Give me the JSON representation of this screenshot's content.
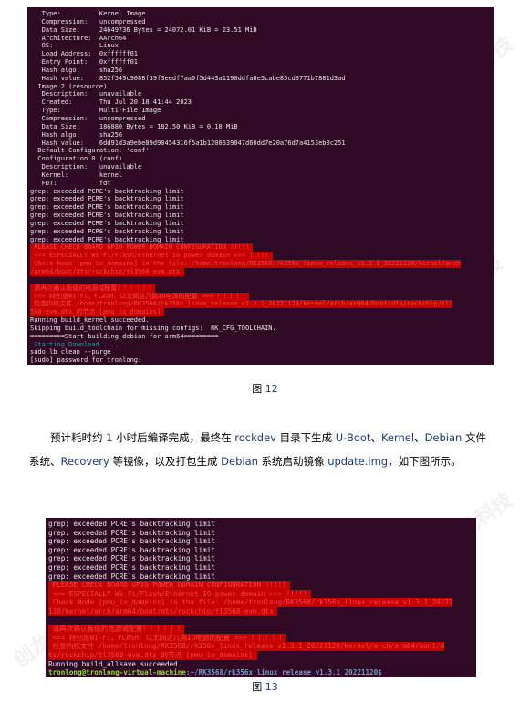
{
  "figure12": {
    "caption_prefix": "图",
    "caption_num": "12",
    "lines": [
      {
        "t": "   Type:          Kernel Image"
      },
      {
        "t": "   Compression:   uncompressed"
      },
      {
        "t": "   Data Size:     24649736 Bytes = 24072.01 KiB = 23.51 MiB"
      },
      {
        "t": "   Architecture:  AArch64"
      },
      {
        "t": "   OS:            Linux"
      },
      {
        "t": "   Load Address:  0xffffff01"
      },
      {
        "t": "   Entry Point:   0xffffff01"
      },
      {
        "t": "   Hash algo:     sha256"
      },
      {
        "t": "   Hash value:    852f549c9088f39f3eedf7aa0f5d443a1190ddfa8e3cabe85cd8771b7881d3ad"
      },
      {
        "t": "  Image 2 (resource)"
      },
      {
        "t": "   Description:   unavailable"
      },
      {
        "t": "   Created:       Thu Jul 20 18:41:44 2023"
      },
      {
        "t": "   Type:          Multi-File Image"
      },
      {
        "t": "   Compression:   uncompressed"
      },
      {
        "t": "   Data Size:     186880 Bytes = 182.50 KiB = 0.18 MiB"
      },
      {
        "t": "   Hash algo:     sha256"
      },
      {
        "t": "   Hash value:    6dd91d3a9ebe89d90454316f5a1b1200639047d60dd7e20a76d7a4153eb0c251"
      },
      {
        "t": "  Default Configuration: 'conf'"
      },
      {
        "t": "  Configuration 0 (conf)"
      },
      {
        "t": "   Description:   unavailable"
      },
      {
        "t": "   Kernel:        kernel"
      },
      {
        "t": "   FDT:           fdt"
      },
      {
        "t": "grep: exceeded PCRE's backtracking limit"
      },
      {
        "t": "grep: exceeded PCRE's backtracking limit"
      },
      {
        "t": "grep: exceeded PCRE's backtracking limit"
      },
      {
        "t": "grep: exceeded PCRE's backtracking limit"
      },
      {
        "t": "grep: exceeded PCRE's backtracking limit"
      },
      {
        "t": "grep: exceeded PCRE's backtracking limit"
      },
      {
        "t": "grep: exceeded PCRE's backtracking limit"
      },
      {
        "t": " PLEASE CHECK BOARD GPIO POWER DOMAIN CONFIGURATION !!!!! ",
        "s": "red"
      },
      {
        "t": " <<< ESPECIALLY Wi-Fi/Flash/Ethernet IO power domain >>> !!!!! ",
        "s": "red"
      },
      {
        "t": " Check Node [pmu_io_domains] in the file: /home/tronlong/RK3568/rk356x_linux_release_v1.3.1_20221120/kernel/arch",
        "s": "red"
      },
      {
        "t": "/arm64/boot/dts/rockchip/tl3568-evm.dts ",
        "s": "red"
      },
      {
        "t": ""
      },
      {
        "t": " 请再次确认板级的电源域配置！！！！！！",
        "s": "red"
      },
      {
        "t": " <<< 特别是Wi-Fi，FLASH，以太网这几路IO电源的配置 >>> ！！！！！",
        "s": "red"
      },
      {
        "t": " 检查内核文件 /home/tronlong/RK3568/rk356x_linux_release_v1.3.1_20221120/kernel/arch/arm64/boot/dts/rockchip/tl3",
        "s": "red"
      },
      {
        "t": "568-evm.dts 的节点 [pmu_io_domains] ",
        "s": "red"
      },
      {
        "t": "Running build_kernel succeeded."
      },
      {
        "t": "Skipping build_toolchain for missing configs:  RK_CFG_TOOLCHAIN."
      },
      {
        "t": "=========Start building debian for arm64========="
      },
      {
        "t": " Starting Download......",
        "s": "cyan"
      },
      {
        "t": "sudo lb clean --purge"
      },
      {
        "t": "[sudo] password for tronlong:"
      }
    ]
  },
  "paragraph": {
    "parts": [
      {
        "t": "预计耗时约 "
      },
      {
        "t": "1",
        "en": true
      },
      {
        "t": " 小时后编译完成，最终在 "
      },
      {
        "t": "rockdev",
        "en": true
      },
      {
        "t": " 目录下生成 "
      },
      {
        "t": "U-Boot",
        "en": true
      },
      {
        "t": "、"
      },
      {
        "t": "Kernel",
        "en": true
      },
      {
        "t": "、"
      },
      {
        "t": "Debian",
        "en": true
      },
      {
        "t": " 文件系统、"
      },
      {
        "t": "Recovery",
        "en": true
      },
      {
        "t": " 等镜像，以及打包生成 "
      },
      {
        "t": "Debian",
        "en": true
      },
      {
        "t": " 系统启动镜像 "
      },
      {
        "t": "update.img",
        "en": true
      },
      {
        "t": "，如下图所示。"
      }
    ]
  },
  "figure13": {
    "caption_prefix": "图",
    "caption_num": "13",
    "lines": [
      {
        "t": "grep: exceeded PCRE's backtracking limit"
      },
      {
        "t": "grep: exceeded PCRE's backtracking limit"
      },
      {
        "t": "grep: exceeded PCRE's backtracking limit"
      },
      {
        "t": "grep: exceeded PCRE's backtracking limit"
      },
      {
        "t": "grep: exceeded PCRE's backtracking limit"
      },
      {
        "t": "grep: exceeded PCRE's backtracking limit"
      },
      {
        "t": "grep: exceeded PCRE's backtracking limit"
      },
      {
        "t": " PLEASE CHECK BOARD GPIO POWER DOMAIN CONFIGURATION !!!!! ",
        "s": "red"
      },
      {
        "t": " <<< ESPECIALLY Wi-Fi/Flash/Ethernet IO power domain >>> !!!!! ",
        "s": "red"
      },
      {
        "t": " Check Node [pmu_io_domains] in the file: /home/tronlong/RK3568/rk356x_linux_release_v1.3.1_20221",
        "s": "red"
      },
      {
        "t": "120/kernel/arch/arm64/boot/dts/rockchip/tl3568-evm.dts ",
        "s": "red"
      },
      {
        "t": ""
      },
      {
        "t": " 请再次确认板级的电源域配置！！！！！！",
        "s": "red"
      },
      {
        "t": " <<< 特别是Wi-Fi，FLASH，以太网这几路IO电源的配置 >>> ！！！！！",
        "s": "red"
      },
      {
        "t": " 检查内核文件 /home/tronlong/RK3568/rk356x_linux_release_v1.3.1_20221120/kernel/arch/arm64/boot/d",
        "s": "red"
      },
      {
        "t": "ts/rockchip/tl3568-evm.dts 的节点 [pmu_io_domains] ",
        "s": "red"
      },
      {
        "t": "Running build_allsave succeeded."
      }
    ],
    "prompt_user": "tronlong@tronlong-virtual-machine",
    "prompt_path": ":~/RK3568/rk356x_linux_release_v1.3.1_20221120$"
  },
  "watermark": "创龙科技",
  "colors": {
    "terminal_bg": "#300a24",
    "highlight_red": "#c80000",
    "link_blue": "#1f3a7a"
  }
}
